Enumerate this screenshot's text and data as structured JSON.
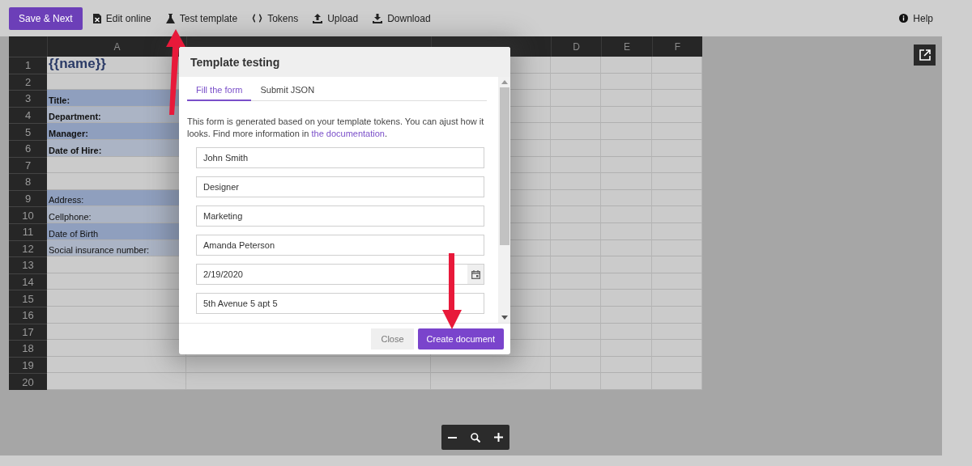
{
  "toolbar": {
    "primary_button": "Save & Next",
    "items": [
      {
        "label": "Edit online",
        "kind": "excel"
      },
      {
        "label": "Test template",
        "kind": "flask"
      },
      {
        "label": "Tokens",
        "kind": "braces"
      },
      {
        "label": "Upload",
        "kind": "upload"
      },
      {
        "label": "Download",
        "kind": "download"
      }
    ],
    "help": "Help"
  },
  "sheet": {
    "columns": [
      "A",
      "D",
      "E",
      "F"
    ],
    "rows": [
      {
        "number": "1",
        "cell": "{{name}}",
        "kind": "title"
      },
      {
        "number": "2",
        "kind": "empty"
      },
      {
        "number": "3",
        "cell": "Title:",
        "color": "#8f9fbe",
        "kind": "bold"
      },
      {
        "number": "4",
        "cell": "Department:",
        "color": "#abb4c5",
        "kind": "bold"
      },
      {
        "number": "5",
        "cell": "Manager:",
        "color": "#8f9fbe",
        "kind": "bold"
      },
      {
        "number": "6",
        "cell": "Date of Hire:",
        "color": "#abb4c5",
        "kind": "bold"
      },
      {
        "number": "7",
        "kind": "empty"
      },
      {
        "number": "8",
        "kind": "empty"
      },
      {
        "number": "9",
        "cell": "Address:",
        "color": "#8f9fbe",
        "kind": "plain"
      },
      {
        "number": "10",
        "cell": "Cellphone:",
        "color": "#abb4c5",
        "kind": "plain"
      },
      {
        "number": "11",
        "cell": "Date of Birth",
        "color": "#8f9fbe",
        "kind": "plain"
      },
      {
        "number": "12",
        "cell": "Social insurance number:",
        "color": "#abb4c5",
        "kind": "plain"
      },
      {
        "number": "13",
        "kind": "empty"
      },
      {
        "number": "14",
        "kind": "empty"
      },
      {
        "number": "15",
        "kind": "empty"
      },
      {
        "number": "16",
        "kind": "empty"
      },
      {
        "number": "17",
        "kind": "empty"
      },
      {
        "number": "18",
        "kind": "empty"
      },
      {
        "number": "19",
        "kind": "empty"
      },
      {
        "number": "20",
        "kind": "empty"
      }
    ]
  },
  "dialog": {
    "title": "Template testing",
    "tabs": [
      {
        "label": "Fill the form",
        "selected": true
      },
      {
        "label": "Submit JSON",
        "selected": false
      }
    ],
    "description": {
      "text": "This form is generated based on your template tokens. You can ajust how it looks. Find more information in ",
      "link": "the documentation",
      "after": "."
    },
    "fields": [
      {
        "value": "John Smith",
        "kind": "text"
      },
      {
        "value": "Designer",
        "kind": "text"
      },
      {
        "value": "Marketing",
        "kind": "text"
      },
      {
        "value": "Amanda Peterson",
        "kind": "text"
      },
      {
        "value": "2/19/2020",
        "kind": "date"
      },
      {
        "value": "5th Avenue 5 apt 5",
        "kind": "text"
      }
    ],
    "buttons": [
      {
        "label": "Close",
        "kind": "secondary"
      },
      {
        "label": "Create document",
        "kind": "primary"
      }
    ]
  }
}
